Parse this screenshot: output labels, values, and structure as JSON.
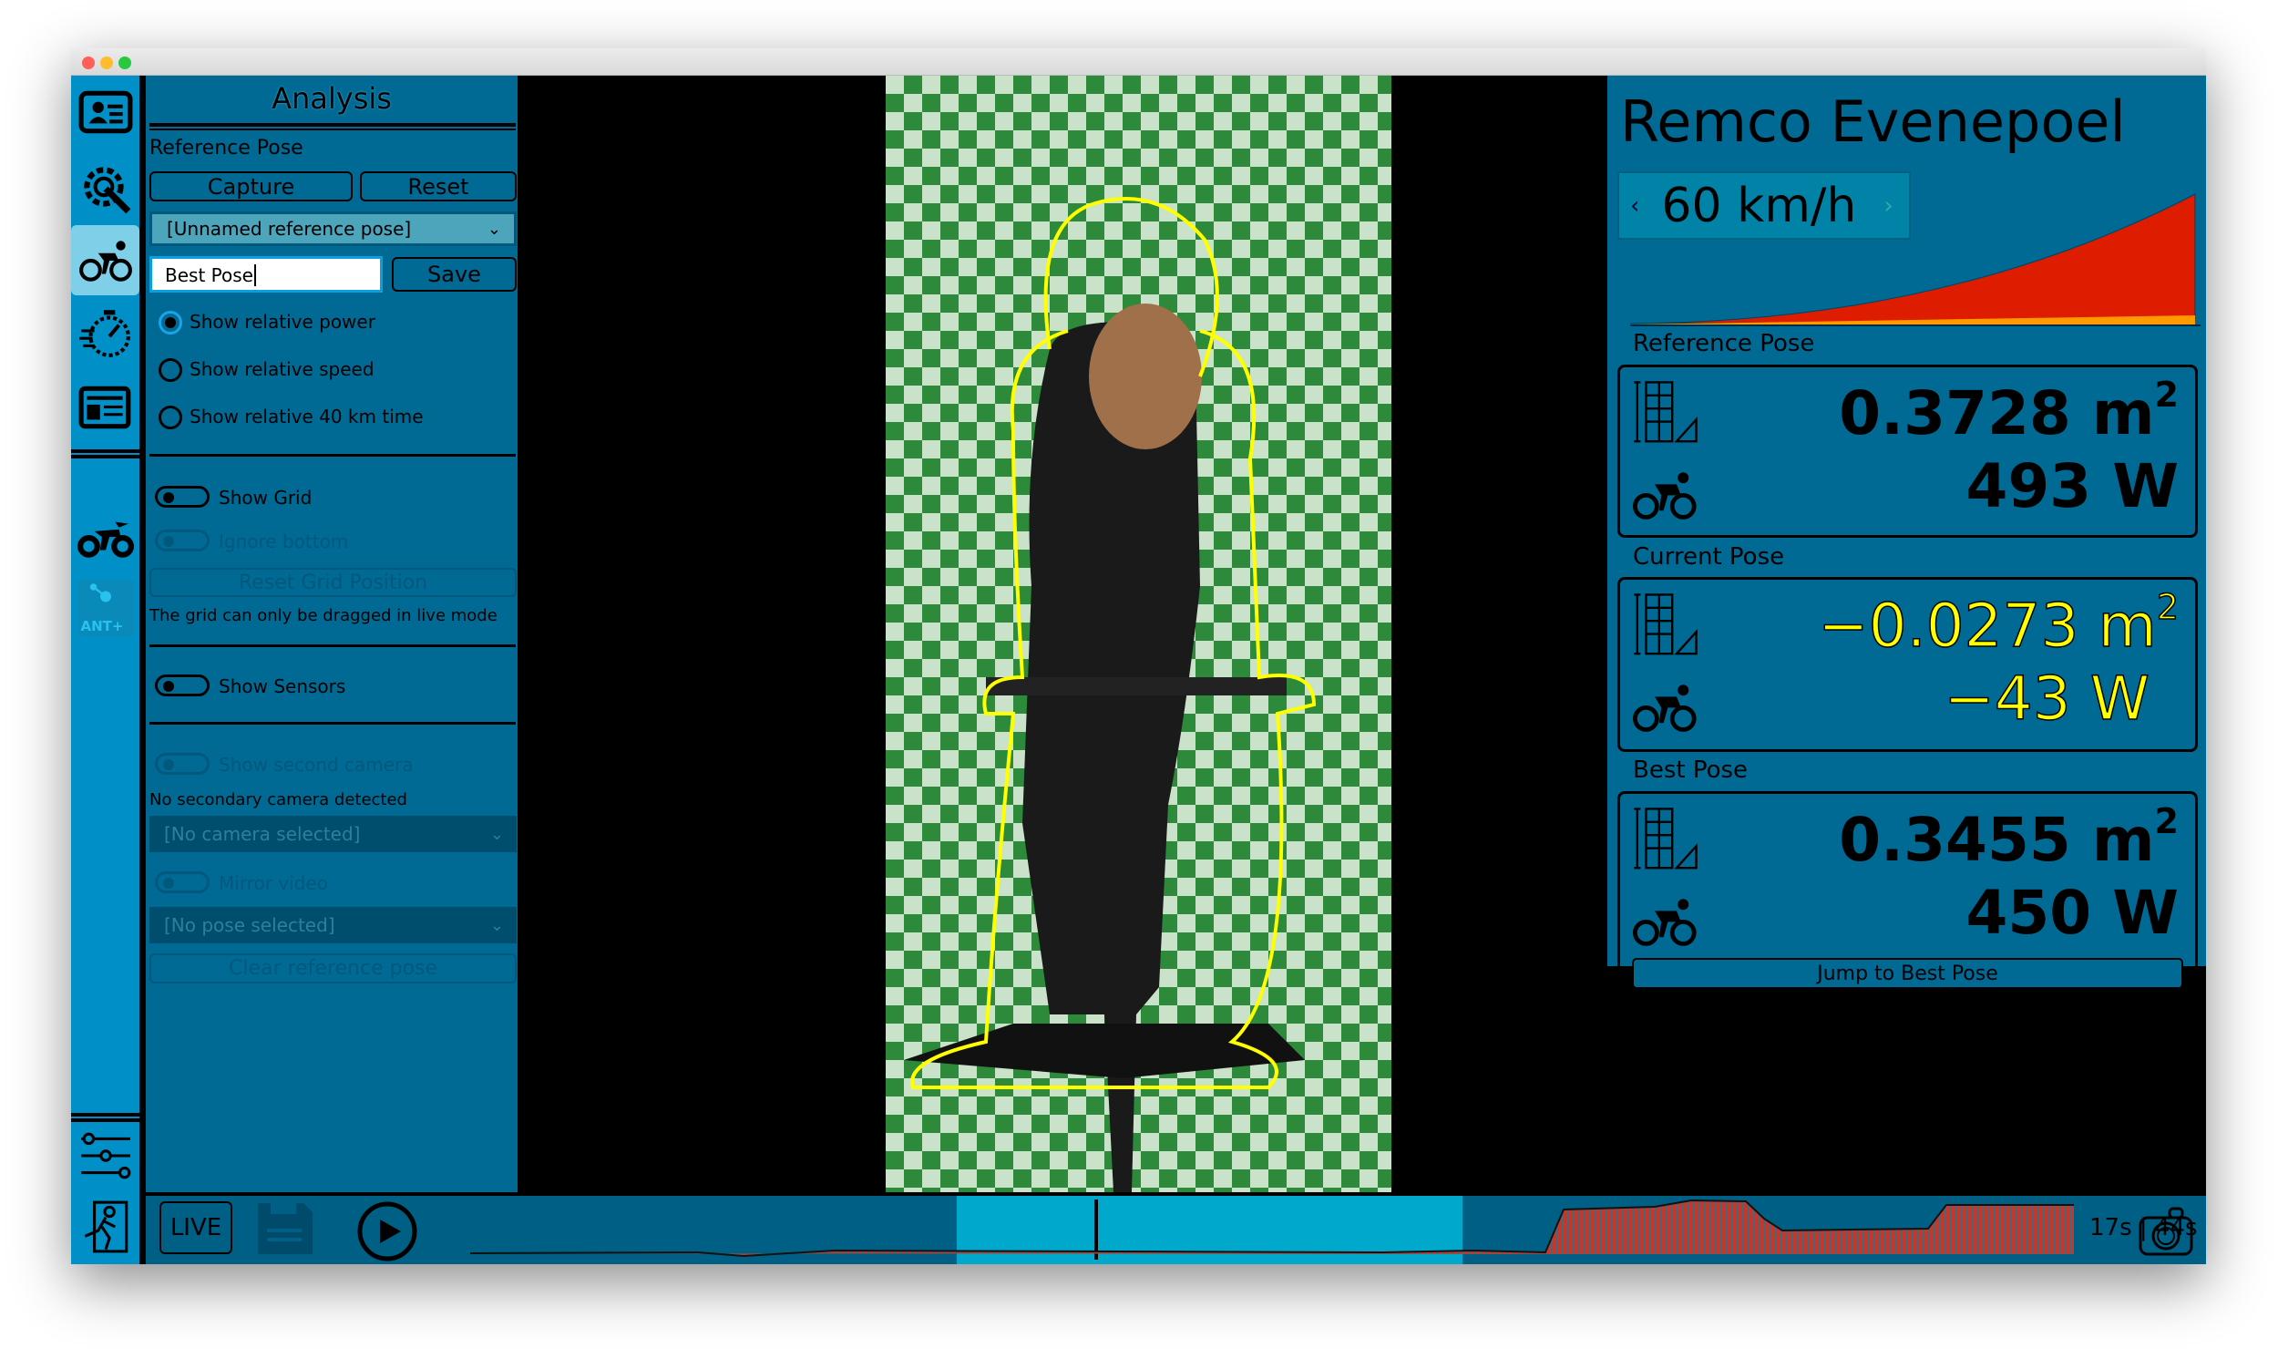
{
  "window": {
    "traffic_lights": [
      "#fe5f57",
      "#febc2e",
      "#28c840"
    ]
  },
  "sidebar": {
    "items": [
      {
        "name": "profile",
        "icon": "id-card-icon"
      },
      {
        "name": "settings",
        "icon": "gear-wrench-icon"
      },
      {
        "name": "analysis",
        "icon": "cyclist-icon",
        "selected": true
      },
      {
        "name": "timer",
        "icon": "stopwatch-icon"
      },
      {
        "name": "report",
        "icon": "newspaper-icon"
      },
      {
        "name": "aero",
        "icon": "aero-cyclist-icon"
      },
      {
        "name": "ant",
        "icon": "ant-plus-icon",
        "label": "ANT+"
      },
      {
        "name": "adjustments",
        "icon": "sliders-icon"
      },
      {
        "name": "exit",
        "icon": "exit-icon"
      }
    ]
  },
  "panel": {
    "title": "Analysis",
    "reference_pose_label": "Reference Pose",
    "capture": "Capture",
    "reset": "Reset",
    "pose_select": "[Unnamed reference pose]",
    "pose_name_value": "Best Pose",
    "save": "Save",
    "radios": [
      {
        "label": "Show relative power",
        "checked": true
      },
      {
        "label": "Show relative speed",
        "checked": false
      },
      {
        "label": "Show relative 40 km time",
        "checked": false
      }
    ],
    "show_grid": "Show Grid",
    "ignore_bottom": "Ignore bottom",
    "reset_grid": "Reset Grid Position",
    "grid_note": "The grid can only be dragged in live mode",
    "show_sensors": "Show Sensors",
    "show_second_camera": "Show second camera",
    "no_secondary": "No secondary camera detected",
    "camera_select": "[No camera selected]",
    "mirror_video": "Mirror video",
    "pose_select2": "[No pose selected]",
    "clear_ref": "Clear reference pose"
  },
  "right": {
    "athlete": "Remco Evenepoel",
    "speed": "60 km/h",
    "colors": {
      "curve": "#dd1c00",
      "base": "#ff9900",
      "highlight": "#ffff00"
    },
    "reference": {
      "label": "Reference Pose",
      "area": "0.3728 m",
      "power": "493 W"
    },
    "current": {
      "label": "Current Pose",
      "area": "−0.0273 m",
      "power": "−43 W"
    },
    "best": {
      "label": "Best Pose",
      "area": "0.3455 m",
      "power": "450 W",
      "jump": "Jump to Best Pose"
    },
    "unit_exp": "2"
  },
  "bottom": {
    "live": "LIVE",
    "time": "17s | 44s"
  }
}
